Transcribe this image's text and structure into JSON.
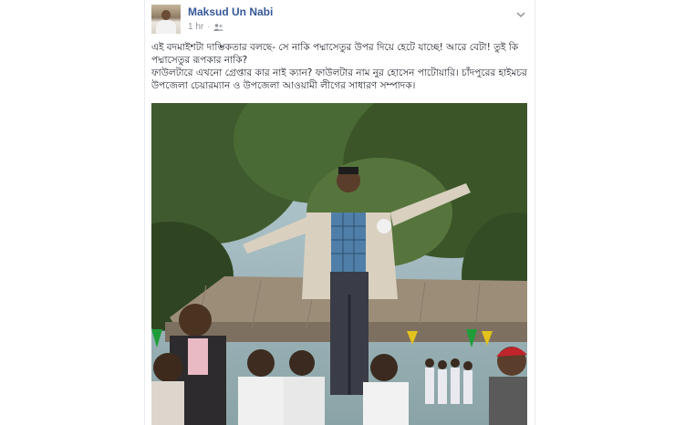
{
  "post": {
    "author_name": "Maksud Un Nabi",
    "timestamp": "1 hr",
    "separator": "·",
    "audience_icon": "friends-icon",
    "options_icon": "chevron-down-icon",
    "text_lines": [
      "এই বদমাইশটা দাম্ভিকতার বলছে- সে নাকি পদ্মাসেতুর উপর দিয়ে হেটে যাচ্ছে! আরে বেটা! তুই কি পদ্মাসেতুর রূপকার নাকি?",
      "ফাউলটারে এখনো গ্রেপ্তার কার নাই ক্যান? ফাউলটার নাম নুর হোসেন পাটোয়ারি। চাঁদপুরের হাইমচর উপজেলা চেয়ারম্যান ও উপজেলা আওয়ামী লীগের সাধারণ সম্পাদক।"
    ]
  },
  "colors": {
    "link_blue": "#365899",
    "meta_gray": "#90949c",
    "text_dark": "#1d2129",
    "card_border": "#e9ebee"
  }
}
